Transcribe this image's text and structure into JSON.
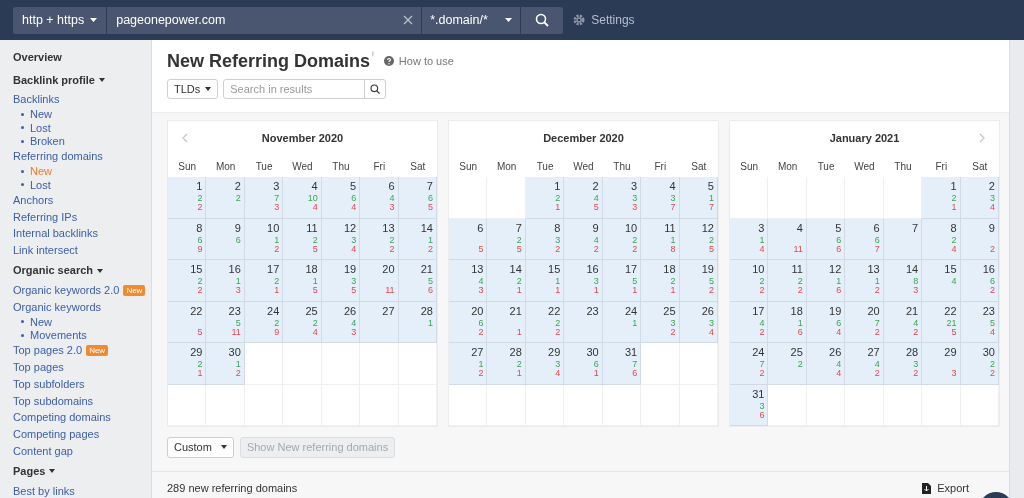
{
  "top_bar": {
    "protocol": "http + https",
    "url": "pageonepower.com",
    "mode": "*.domain/*",
    "settings": "Settings"
  },
  "sidebar": {
    "items": [
      {
        "kind": "heading",
        "label": "Overview"
      },
      {
        "kind": "heading",
        "label": "Backlink profile",
        "expanded": true
      },
      {
        "kind": "link",
        "label": "Backlinks",
        "selected": false
      },
      {
        "kind": "sub",
        "label": "New",
        "selected": false
      },
      {
        "kind": "sub",
        "label": "Lost",
        "selected": false
      },
      {
        "kind": "sub",
        "label": "Broken",
        "selected": false
      },
      {
        "kind": "link",
        "label": "Referring domains",
        "selected": false
      },
      {
        "kind": "sub",
        "label": "New",
        "selected": true
      },
      {
        "kind": "sub",
        "label": "Lost",
        "selected": false
      },
      {
        "kind": "link",
        "label": "Anchors",
        "selected": false
      },
      {
        "kind": "link",
        "label": "Referring IPs",
        "selected": false
      },
      {
        "kind": "link",
        "label": "Internal backlinks",
        "selected": false
      },
      {
        "kind": "link",
        "label": "Link intersect",
        "selected": false
      },
      {
        "kind": "heading",
        "label": "Organic search",
        "expanded": true
      },
      {
        "kind": "link",
        "label": "Organic keywords 2.0",
        "badge": "New",
        "selected": false
      },
      {
        "kind": "link",
        "label": "Organic keywords",
        "selected": false
      },
      {
        "kind": "sub",
        "label": "New",
        "selected": false
      },
      {
        "kind": "sub",
        "label": "Movements",
        "selected": false
      },
      {
        "kind": "link",
        "label": "Top pages 2.0",
        "badge": "New",
        "selected": false
      },
      {
        "kind": "link",
        "label": "Top pages",
        "selected": false
      },
      {
        "kind": "link",
        "label": "Top subfolders",
        "selected": false
      },
      {
        "kind": "link",
        "label": "Top subdomains",
        "selected": false
      },
      {
        "kind": "link",
        "label": "Competing domains",
        "selected": false
      },
      {
        "kind": "link",
        "label": "Competing pages",
        "selected": false
      },
      {
        "kind": "link",
        "label": "Content gap",
        "selected": false
      },
      {
        "kind": "heading",
        "label": "Pages",
        "expanded": true
      },
      {
        "kind": "link",
        "label": "Best by links",
        "selected": false
      }
    ]
  },
  "header": {
    "title": "New Referring Domains",
    "info_mark": "i",
    "help_link": "How to use",
    "filter": "TLDs",
    "search": {
      "placeholder": "Search in results"
    }
  },
  "calendars": [
    {
      "title": "November 2020",
      "weekdays": [
        "Sun",
        "Mon",
        "Tue",
        "Wed",
        "Thu",
        "Fri",
        "Sat"
      ],
      "weeks": [
        [
          {
            "kind": "day",
            "day": "1",
            "gained": "2",
            "lost": "2"
          },
          {
            "kind": "day",
            "day": "2",
            "gained": "2"
          },
          {
            "kind": "day",
            "day": "3",
            "gained": "7",
            "lost": "3"
          },
          {
            "kind": "day",
            "day": "4",
            "gained": "10",
            "lost": "4"
          },
          {
            "kind": "day",
            "day": "5",
            "gained": "6",
            "lost": "4"
          },
          {
            "kind": "day",
            "day": "6",
            "gained": "4",
            "lost": "3"
          },
          {
            "kind": "day",
            "day": "7",
            "gained": "6",
            "lost": "5"
          }
        ],
        [
          {
            "kind": "day",
            "day": "8",
            "gained": "6",
            "lost": "9"
          },
          {
            "kind": "day",
            "day": "9",
            "gained": "6"
          },
          {
            "kind": "day",
            "day": "10",
            "gained": "1",
            "lost": "2"
          },
          {
            "kind": "day",
            "day": "11",
            "gained": "2",
            "lost": "5"
          },
          {
            "kind": "day",
            "day": "12",
            "gained": "3",
            "lost": "4"
          },
          {
            "kind": "day",
            "day": "13",
            "gained": "2",
            "lost": "2"
          },
          {
            "kind": "day",
            "day": "14",
            "gained": "1",
            "lost": "2"
          }
        ],
        [
          {
            "kind": "day",
            "day": "15",
            "gained": "2",
            "lost": "2"
          },
          {
            "kind": "day",
            "day": "16",
            "gained": "1",
            "lost": "3"
          },
          {
            "kind": "day",
            "day": "17",
            "gained": "2",
            "lost": "1"
          },
          {
            "kind": "day",
            "day": "18",
            "gained": "1",
            "lost": "5"
          },
          {
            "kind": "day",
            "day": "19",
            "gained": "3",
            "lost": "5"
          },
          {
            "kind": "day",
            "day": "20",
            "lost": "11"
          },
          {
            "kind": "day",
            "day": "21",
            "gained": "5",
            "lost": "6"
          }
        ],
        [
          {
            "kind": "day",
            "day": "22",
            "lost": "5"
          },
          {
            "kind": "day",
            "day": "23",
            "gained": "5",
            "lost": "11"
          },
          {
            "kind": "day",
            "day": "24",
            "gained": "2",
            "lost": "9"
          },
          {
            "kind": "day",
            "day": "25",
            "gained": "2",
            "lost": "4"
          },
          {
            "kind": "day",
            "day": "26",
            "gained": "4",
            "lost": "3"
          },
          {
            "kind": "day",
            "day": "27"
          },
          {
            "kind": "day",
            "day": "28",
            "gained": "1"
          }
        ],
        [
          {
            "kind": "day",
            "day": "29",
            "gained": "2",
            "lost": "1"
          },
          {
            "kind": "day",
            "day": "30",
            "gained": "1",
            "lost": "2"
          },
          {
            "kind": "empty"
          },
          {
            "kind": "empty"
          },
          {
            "kind": "empty"
          },
          {
            "kind": "empty"
          },
          {
            "kind": "empty"
          }
        ],
        [
          {
            "kind": "empty"
          },
          {
            "kind": "empty"
          },
          {
            "kind": "empty"
          },
          {
            "kind": "empty"
          },
          {
            "kind": "empty"
          },
          {
            "kind": "empty"
          },
          {
            "kind": "empty"
          }
        ]
      ]
    },
    {
      "title": "December 2020",
      "weekdays": [
        "Sun",
        "Mon",
        "Tue",
        "Wed",
        "Thu",
        "Fri",
        "Sat"
      ],
      "weeks": [
        [
          {
            "kind": "empty"
          },
          {
            "kind": "empty"
          },
          {
            "kind": "day",
            "day": "1",
            "gained": "2",
            "lost": "1"
          },
          {
            "kind": "day",
            "day": "2",
            "gained": "4",
            "lost": "5"
          },
          {
            "kind": "day",
            "day": "3",
            "gained": "3",
            "lost": "3"
          },
          {
            "kind": "day",
            "day": "4",
            "gained": "3",
            "lost": "7"
          },
          {
            "kind": "day",
            "day": "5",
            "gained": "1",
            "lost": "7"
          }
        ],
        [
          {
            "kind": "day",
            "day": "6",
            "lost": "5"
          },
          {
            "kind": "day",
            "day": "7",
            "gained": "2",
            "lost": "5"
          },
          {
            "kind": "day",
            "day": "8",
            "gained": "3",
            "lost": "2"
          },
          {
            "kind": "day",
            "day": "9",
            "gained": "4",
            "lost": "2"
          },
          {
            "kind": "day",
            "day": "10",
            "gained": "2",
            "lost": "2"
          },
          {
            "kind": "day",
            "day": "11",
            "gained": "1",
            "lost": "8"
          },
          {
            "kind": "day",
            "day": "12",
            "gained": "2",
            "lost": "5"
          }
        ],
        [
          {
            "kind": "day",
            "day": "13",
            "gained": "4",
            "lost": "3"
          },
          {
            "kind": "day",
            "day": "14",
            "gained": "2",
            "lost": "1"
          },
          {
            "kind": "day",
            "day": "15",
            "gained": "1",
            "lost": "1"
          },
          {
            "kind": "day",
            "day": "16",
            "gained": "3",
            "lost": "1"
          },
          {
            "kind": "day",
            "day": "17",
            "gained": "5",
            "lost": "1"
          },
          {
            "kind": "day",
            "day": "18",
            "gained": "2",
            "lost": "1"
          },
          {
            "kind": "day",
            "day": "19",
            "gained": "5",
            "lost": "2"
          }
        ],
        [
          {
            "kind": "day",
            "day": "20",
            "gained": "6",
            "lost": "2"
          },
          {
            "kind": "day",
            "day": "21",
            "lost": "1"
          },
          {
            "kind": "day",
            "day": "22",
            "gained": "2",
            "lost": "2"
          },
          {
            "kind": "day",
            "day": "23"
          },
          {
            "kind": "day",
            "day": "24",
            "gained": "1"
          },
          {
            "kind": "day",
            "day": "25",
            "gained": "3",
            "lost": "2"
          },
          {
            "kind": "day",
            "day": "26",
            "gained": "3",
            "lost": "4"
          }
        ],
        [
          {
            "kind": "day",
            "day": "27",
            "gained": "1",
            "lost": "2"
          },
          {
            "kind": "day",
            "day": "28",
            "gained": "2",
            "lost": "1"
          },
          {
            "kind": "day",
            "day": "29",
            "gained": "3",
            "lost": "4"
          },
          {
            "kind": "day",
            "day": "30",
            "gained": "6",
            "lost": "1"
          },
          {
            "kind": "day",
            "day": "31",
            "gained": "7",
            "lost": "6"
          },
          {
            "kind": "empty"
          },
          {
            "kind": "empty"
          }
        ],
        [
          {
            "kind": "empty"
          },
          {
            "kind": "empty"
          },
          {
            "kind": "empty"
          },
          {
            "kind": "empty"
          },
          {
            "kind": "empty"
          },
          {
            "kind": "empty"
          },
          {
            "kind": "empty"
          }
        ]
      ]
    },
    {
      "title": "January 2021",
      "weekdays": [
        "Sun",
        "Mon",
        "Tue",
        "Wed",
        "Thu",
        "Fri",
        "Sat"
      ],
      "weeks": [
        [
          {
            "kind": "empty"
          },
          {
            "kind": "empty"
          },
          {
            "kind": "empty"
          },
          {
            "kind": "empty"
          },
          {
            "kind": "empty"
          },
          {
            "kind": "day",
            "day": "1",
            "gained": "2",
            "lost": "1"
          },
          {
            "kind": "day",
            "day": "2",
            "gained": "3",
            "lost": "4"
          }
        ],
        [
          {
            "kind": "day",
            "day": "3",
            "gained": "1",
            "lost": "4"
          },
          {
            "kind": "day",
            "day": "4",
            "lost": "11"
          },
          {
            "kind": "day",
            "day": "5",
            "gained": "6",
            "lost": "6"
          },
          {
            "kind": "day",
            "day": "6",
            "gained": "6",
            "lost": "7"
          },
          {
            "kind": "day",
            "day": "7"
          },
          {
            "kind": "day",
            "day": "8",
            "gained": "2",
            "lost": "4"
          },
          {
            "kind": "day",
            "day": "9",
            "lost": "2"
          }
        ],
        [
          {
            "kind": "day",
            "day": "10",
            "gained": "2",
            "lost": "2"
          },
          {
            "kind": "day",
            "day": "11",
            "gained": "2",
            "lost": "2"
          },
          {
            "kind": "day",
            "day": "12",
            "gained": "1",
            "lost": "6"
          },
          {
            "kind": "day",
            "day": "13",
            "gained": "1",
            "lost": "2"
          },
          {
            "kind": "day",
            "day": "14",
            "gained": "8",
            "lost": "3"
          },
          {
            "kind": "day",
            "day": "15",
            "gained": "4"
          },
          {
            "kind": "day",
            "day": "16",
            "gained": "6",
            "lost": "2"
          }
        ],
        [
          {
            "kind": "day",
            "day": "17",
            "gained": "4",
            "lost": "2"
          },
          {
            "kind": "day",
            "day": "18",
            "gained": "1",
            "lost": "6"
          },
          {
            "kind": "day",
            "day": "19",
            "gained": "6",
            "lost": "4"
          },
          {
            "kind": "day",
            "day": "20",
            "gained": "7",
            "lost": "2"
          },
          {
            "kind": "day",
            "day": "21",
            "gained": "4",
            "lost": "2"
          },
          {
            "kind": "day",
            "day": "22",
            "gained": "21",
            "lost": "5"
          },
          {
            "kind": "day",
            "day": "23",
            "gained": "5",
            "lost": "4"
          }
        ],
        [
          {
            "kind": "day",
            "day": "24",
            "gained": "7",
            "lost": "2"
          },
          {
            "kind": "day",
            "day": "25",
            "gained": "2"
          },
          {
            "kind": "day",
            "day": "26",
            "gained": "4",
            "lost": "4"
          },
          {
            "kind": "day",
            "day": "27",
            "gained": "4",
            "lost": "2"
          },
          {
            "kind": "day",
            "day": "28",
            "gained": "3",
            "lost": "2"
          },
          {
            "kind": "day",
            "day": "29",
            "lost": "3"
          },
          {
            "kind": "day",
            "day": "30",
            "gained": "2",
            "lost": "2"
          }
        ],
        [
          {
            "kind": "day",
            "day": "31",
            "gained": "3",
            "lost": "6"
          },
          {
            "kind": "empty"
          },
          {
            "kind": "empty"
          },
          {
            "kind": "empty"
          },
          {
            "kind": "empty"
          },
          {
            "kind": "empty"
          },
          {
            "kind": "empty"
          }
        ]
      ]
    }
  ],
  "range": {
    "select": "Custom",
    "button": "Show New referring domains",
    "button_disabled": true
  },
  "footer": {
    "count": "289 new referring domains",
    "export": "Export"
  }
}
